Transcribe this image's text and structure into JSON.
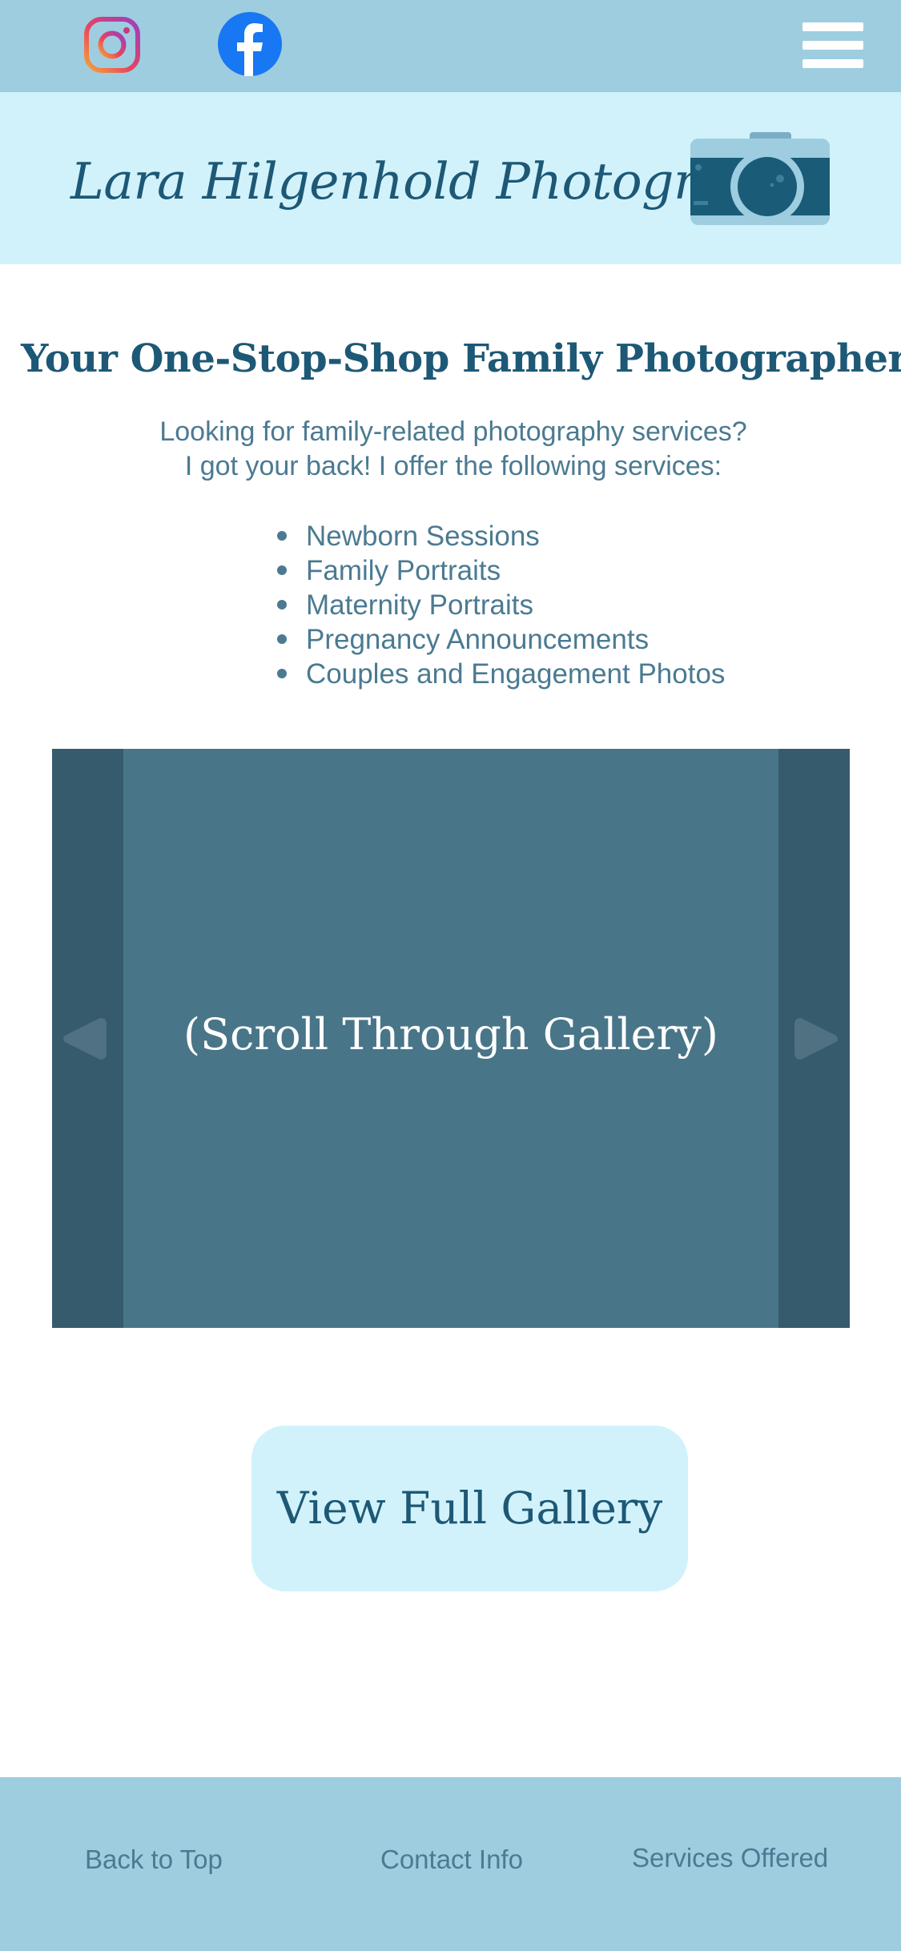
{
  "topbar": {
    "instagram_icon": "instagram-icon",
    "facebook_icon": "facebook-icon",
    "menu_icon": "hamburger-menu-icon"
  },
  "header": {
    "brand": "Lara Hilgenhold Photography",
    "logo_icon": "camera-icon"
  },
  "main": {
    "headline": "Your One-Stop-Shop Family Photographer!",
    "intro_line1": "Looking for family-related photography services?",
    "intro_line2": "I got your back! I offer the following services:",
    "services": [
      "Newborn Sessions",
      "Family Portraits",
      "Maternity Portraits",
      "Pregnancy Announcements",
      "Couples and Engagement Photos"
    ],
    "gallery_text": "(Scroll Through Gallery)",
    "gallery_prev_icon": "arrow-left-icon",
    "gallery_next_icon": "arrow-right-icon",
    "view_gallery_label": "View Full Gallery"
  },
  "footer": {
    "links": [
      "Back to Top",
      "Contact Info",
      "Services Offered"
    ]
  },
  "colors": {
    "topbar": "#9ecde0",
    "header": "#d1f2fb",
    "heading_text": "#1d5876",
    "body_text": "#4b7a92",
    "gallery_bg": "#355b6c",
    "gallery_slide": "#497589"
  }
}
